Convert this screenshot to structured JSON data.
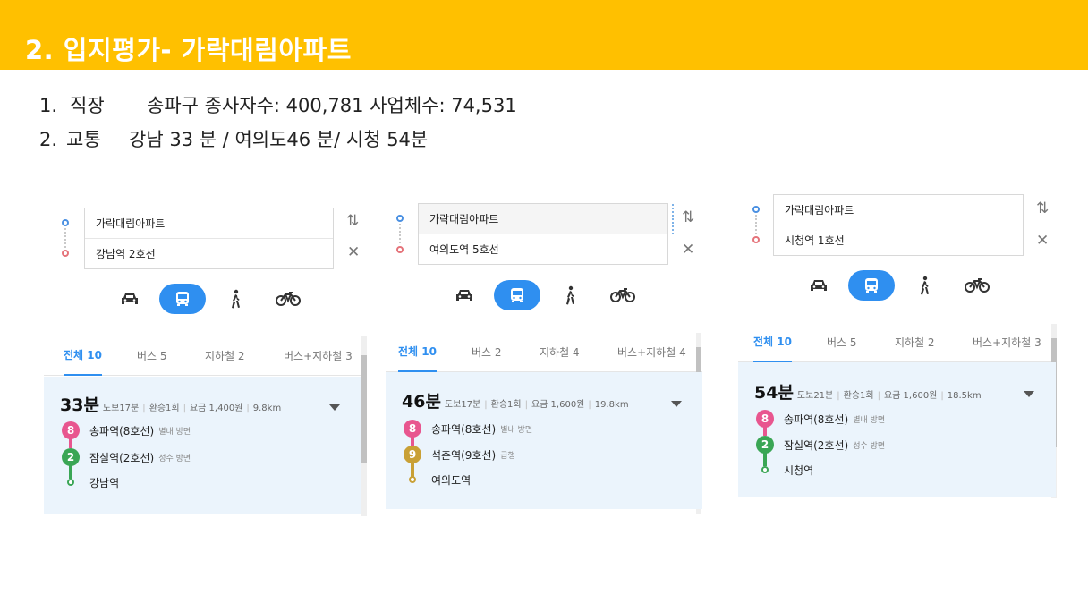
{
  "slide": {
    "title": "2. 입지평가- 가락대림아파트",
    "bullets": [
      {
        "num": "1.",
        "label": "직장",
        "text": "송파구 종사자수: 400,781 사업체수: 74,531"
      },
      {
        "num": "2.",
        "label": "교통",
        "text": "강남 33 분 / 여의도46 분/ 시청 54분"
      }
    ]
  },
  "panels": [
    {
      "origin": "가락대림아파트",
      "destination": "강남역 2호선",
      "tabs": [
        "전체 10",
        "버스 5",
        "지하철 2",
        "버스+지하철 3"
      ],
      "route": {
        "time": "33분",
        "meta": [
          "도보17분",
          "환승1회",
          "요금 1,400원",
          "9.8km"
        ],
        "stops": [
          {
            "badge": "8",
            "color": "#e8568f",
            "name": "송파역(8호선)",
            "dir": "별내 방면"
          },
          {
            "badge": "2",
            "color": "#3aa655",
            "name": "잠실역(2호선)",
            "dir": "성수 방면"
          },
          {
            "badge": "",
            "color": "#3aa655",
            "name": "강남역",
            "dir": ""
          }
        ]
      }
    },
    {
      "origin": "가락대림아파트",
      "destination": "여의도역 5호선",
      "tabs": [
        "전체 10",
        "버스 2",
        "지하철 4",
        "버스+지하철 4"
      ],
      "route": {
        "time": "46분",
        "meta": [
          "도보17분",
          "환승1회",
          "요금 1,600원",
          "19.8km"
        ],
        "stops": [
          {
            "badge": "8",
            "color": "#e8568f",
            "name": "송파역(8호선)",
            "dir": "별내 방면"
          },
          {
            "badge": "9",
            "color": "#c9a035",
            "name": "석촌역(9호선)",
            "dir": "급행"
          },
          {
            "badge": "",
            "color": "#c9a035",
            "name": "여의도역",
            "dir": ""
          }
        ]
      }
    },
    {
      "origin": "가락대림아파트",
      "destination": "시청역 1호선",
      "tabs": [
        "전체 10",
        "버스 5",
        "지하철 2",
        "버스+지하철 3"
      ],
      "route": {
        "time": "54분",
        "meta": [
          "도보21분",
          "환승1회",
          "요금 1,600원",
          "18.5km"
        ],
        "stops": [
          {
            "badge": "8",
            "color": "#e8568f",
            "name": "송파역(8호선)",
            "dir": "별내 방면"
          },
          {
            "badge": "2",
            "color": "#3aa655",
            "name": "잠실역(2호선)",
            "dir": "성수 방면"
          },
          {
            "badge": "",
            "color": "#3aa655",
            "name": "시청역",
            "dir": ""
          }
        ]
      }
    }
  ],
  "icons": {
    "swap": "swap-direction-icon",
    "close": "close-icon",
    "modes": [
      "car-icon",
      "bus-icon",
      "walk-icon",
      "bicycle-icon"
    ]
  },
  "colors": {
    "title_bar": "#FFC000",
    "accent": "#2f8ff0",
    "route_bg": "#ebf4fc"
  }
}
